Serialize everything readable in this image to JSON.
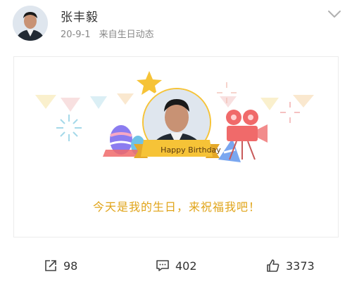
{
  "post": {
    "author": "张丰毅",
    "date": "20-9-1",
    "source": "来自生日动态",
    "card": {
      "banner": "Happy Birthday",
      "message": "今天是我的生日，来祝福我吧！"
    },
    "actions": {
      "share_count": "98",
      "comment_count": "402",
      "like_count": "3373"
    }
  },
  "colors": {
    "accent": "#e0a419",
    "banner": "#f6c337",
    "text": "#333333",
    "muted": "#888888"
  },
  "icons": [
    "chevron-down-icon",
    "share-icon",
    "comment-icon",
    "like-icon",
    "star-icon",
    "movie-camera-icon",
    "easter-egg-icon",
    "party-hat-icon",
    "firework-icon"
  ]
}
